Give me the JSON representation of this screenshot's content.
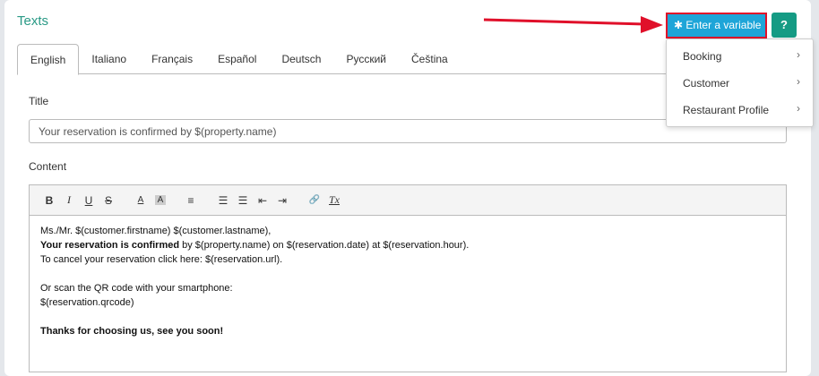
{
  "section_title": "Texts",
  "tabs": [
    "English",
    "Italiano",
    "Français",
    "Español",
    "Deutsch",
    "Русский",
    "Čeština"
  ],
  "title_label": "Title",
  "title_value": "Your reservation is confirmed by $(property.name)",
  "content_label": "Content",
  "toolbar": {
    "bold": "B",
    "italic": "I",
    "underline": "U",
    "strike": "S",
    "font_color": "A",
    "bg_color": "A",
    "align": "≡",
    "ol": "☰",
    "ul": "☰",
    "outdent": "⇤",
    "indent": "⇥",
    "link": "🔗",
    "clear": "Tx"
  },
  "content": {
    "line1": "Ms./Mr. $(customer.firstname) $(customer.lastname),",
    "line2_bold": "Your reservation is confirmed",
    "line2_rest": " by $(property.name) on $(reservation.date) at $(reservation.hour).",
    "line3": "To cancel your reservation click here: $(reservation.url).",
    "line4": "Or scan the QR code with your smartphone:",
    "line5": "$(reservation.qrcode)",
    "line6": "Thanks for choosing us, see you soon!"
  },
  "enter_variable": {
    "icon": "✱",
    "label": "Enter a variable"
  },
  "help_label": "?",
  "menu": [
    {
      "label": "Booking"
    },
    {
      "label": "Customer"
    },
    {
      "label": "Restaurant Profile"
    }
  ],
  "chevron": "›"
}
